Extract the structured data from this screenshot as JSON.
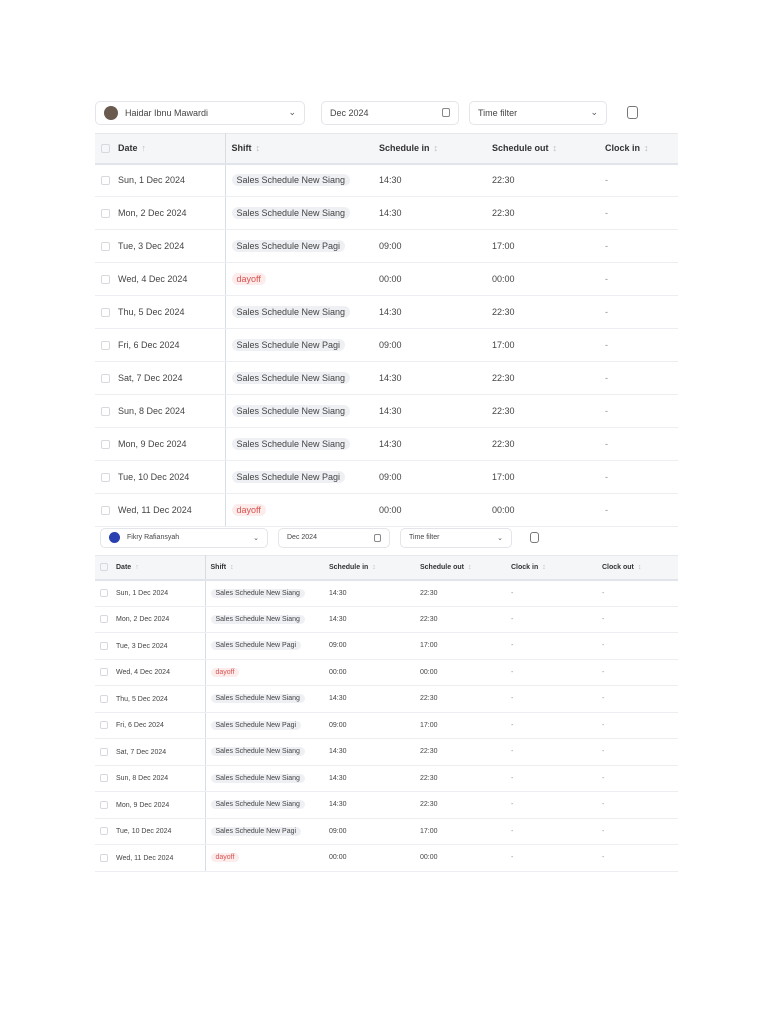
{
  "panels": [
    {
      "employee": "Haidar Ibnu Mawardi",
      "month": "Dec 2024",
      "time_filter": "Time filter",
      "columns": [
        "Date",
        "Shift",
        "Schedule in",
        "Schedule out",
        "Clock in"
      ],
      "rows": [
        [
          "Sun, 1 Dec 2024",
          "Sales Schedule New Siang",
          "14:30",
          "22:30",
          "-"
        ],
        [
          "Mon, 2 Dec 2024",
          "Sales Schedule New Siang",
          "14:30",
          "22:30",
          "-"
        ],
        [
          "Tue, 3 Dec 2024",
          "Sales Schedule New Pagi",
          "09:00",
          "17:00",
          "-"
        ],
        [
          "Wed, 4 Dec 2024",
          "dayoff",
          "00:00",
          "00:00",
          "-"
        ],
        [
          "Thu, 5 Dec 2024",
          "Sales Schedule New Siang",
          "14:30",
          "22:30",
          "-"
        ],
        [
          "Fri, 6 Dec 2024",
          "Sales Schedule New Pagi",
          "09:00",
          "17:00",
          "-"
        ],
        [
          "Sat, 7 Dec 2024",
          "Sales Schedule New Siang",
          "14:30",
          "22:30",
          "-"
        ],
        [
          "Sun, 8 Dec 2024",
          "Sales Schedule New Siang",
          "14:30",
          "22:30",
          "-"
        ],
        [
          "Mon, 9 Dec 2024",
          "Sales Schedule New Siang",
          "14:30",
          "22:30",
          "-"
        ],
        [
          "Tue, 10 Dec 2024",
          "Sales Schedule New Pagi",
          "09:00",
          "17:00",
          "-"
        ],
        [
          "Wed, 11 Dec 2024",
          "dayoff",
          "00:00",
          "00:00",
          "-"
        ]
      ]
    },
    {
      "employee": "Fikry Rafiansyah",
      "month": "Dec 2024",
      "time_filter": "Time filter",
      "columns": [
        "Date",
        "Shift",
        "Schedule in",
        "Schedule out",
        "Clock in",
        "Clock out"
      ],
      "rows": [
        [
          "Sun, 1 Dec 2024",
          "Sales Schedule New Siang",
          "14:30",
          "22:30",
          "-",
          "-"
        ],
        [
          "Mon, 2 Dec 2024",
          "Sales Schedule New Siang",
          "14:30",
          "22:30",
          "-",
          "-"
        ],
        [
          "Tue, 3 Dec 2024",
          "Sales Schedule New Pagi",
          "09:00",
          "17:00",
          "-",
          "-"
        ],
        [
          "Wed, 4 Dec 2024",
          "dayoff",
          "00:00",
          "00:00",
          "-",
          "-"
        ],
        [
          "Thu, 5 Dec 2024",
          "Sales Schedule New Siang",
          "14:30",
          "22:30",
          "-",
          "-"
        ],
        [
          "Fri, 6 Dec 2024",
          "Sales Schedule New Pagi",
          "09:00",
          "17:00",
          "-",
          "-"
        ],
        [
          "Sat, 7 Dec 2024",
          "Sales Schedule New Siang",
          "14:30",
          "22:30",
          "-",
          "-"
        ],
        [
          "Sun, 8 Dec 2024",
          "Sales Schedule New Siang",
          "14:30",
          "22:30",
          "-",
          "-"
        ],
        [
          "Mon, 9 Dec 2024",
          "Sales Schedule New Siang",
          "14:30",
          "22:30",
          "-",
          "-"
        ],
        [
          "Tue, 10 Dec 2024",
          "Sales Schedule New Pagi",
          "09:00",
          "17:00",
          "-",
          "-"
        ],
        [
          "Wed, 11 Dec 2024",
          "dayoff",
          "00:00",
          "00:00",
          "-",
          "-"
        ]
      ]
    }
  ],
  "colors": {
    "dayoff_text": "#d9534f",
    "dayoff_bg": "#fdecec",
    "pill_bg": "#eef0f3",
    "header_bg": "#f5f6f8"
  }
}
